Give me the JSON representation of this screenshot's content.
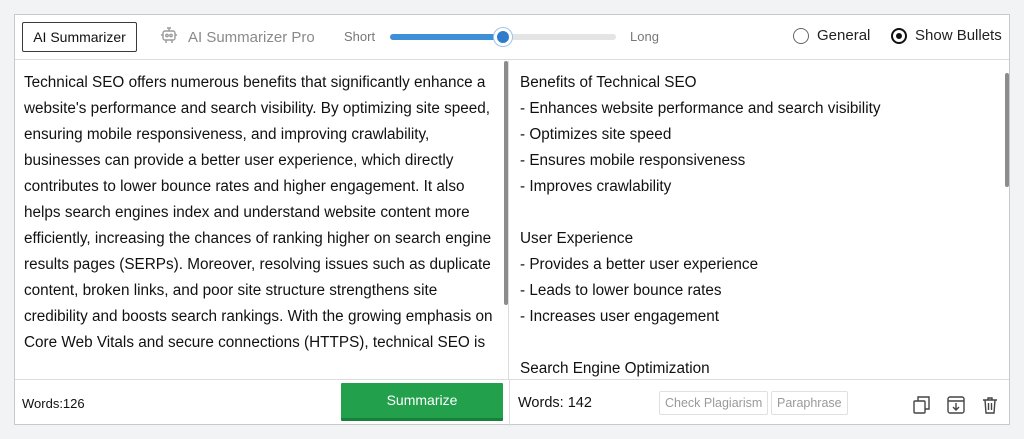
{
  "toolbar": {
    "active_tab": "AI Summarizer",
    "pro_tab": "AI Summarizer Pro",
    "length_short": "Short",
    "length_long": "Long",
    "length_level": 0.5,
    "mode_general": "General",
    "mode_bullets": "Show Bullets",
    "selected_mode": "Show Bullets"
  },
  "input": {
    "text": "Technical SEO offers numerous benefits that significantly enhance a website's performance and search visibility. By optimizing site speed, ensuring mobile responsiveness, and improving crawlability, businesses can provide a better user experience, which directly contributes to lower bounce rates and higher engagement. It also helps search engines index and understand website content more efficiently, increasing the chances of ranking higher on search engine results pages (SERPs). Moreover, resolving issues such as duplicate content, broken links, and poor site structure strengthens site credibility and boosts search rankings. With the growing emphasis on Core Web Vitals and secure connections (HTTPS), technical SEO is",
    "word_count": "Words:126"
  },
  "summary": {
    "sections": [
      {
        "heading": "Benefits of Technical SEO",
        "bullets": [
          "- Enhances website performance and search visibility",
          "- Optimizes site speed",
          "- Ensures mobile responsiveness",
          "- Improves crawlability"
        ]
      },
      {
        "heading": "User Experience",
        "bullets": [
          "- Provides a better user experience",
          "- Leads to lower bounce rates",
          "- Increases user engagement"
        ]
      },
      {
        "heading": "Search Engine Optimization",
        "bullets": []
      }
    ],
    "word_count": "Words: 142"
  },
  "footer": {
    "summarize_label": "Summarize",
    "check_plagiarism_label": "Check Plagiarism",
    "paraphrase_label": "Paraphrase"
  },
  "icons": {
    "copy": "copy-icon",
    "download": "download-icon",
    "delete": "trash-icon",
    "pro": "robot-icon"
  },
  "colors": {
    "accent": "#2f7ccc",
    "primary_button": "#22a04b",
    "muted": "#8a8a8a"
  }
}
